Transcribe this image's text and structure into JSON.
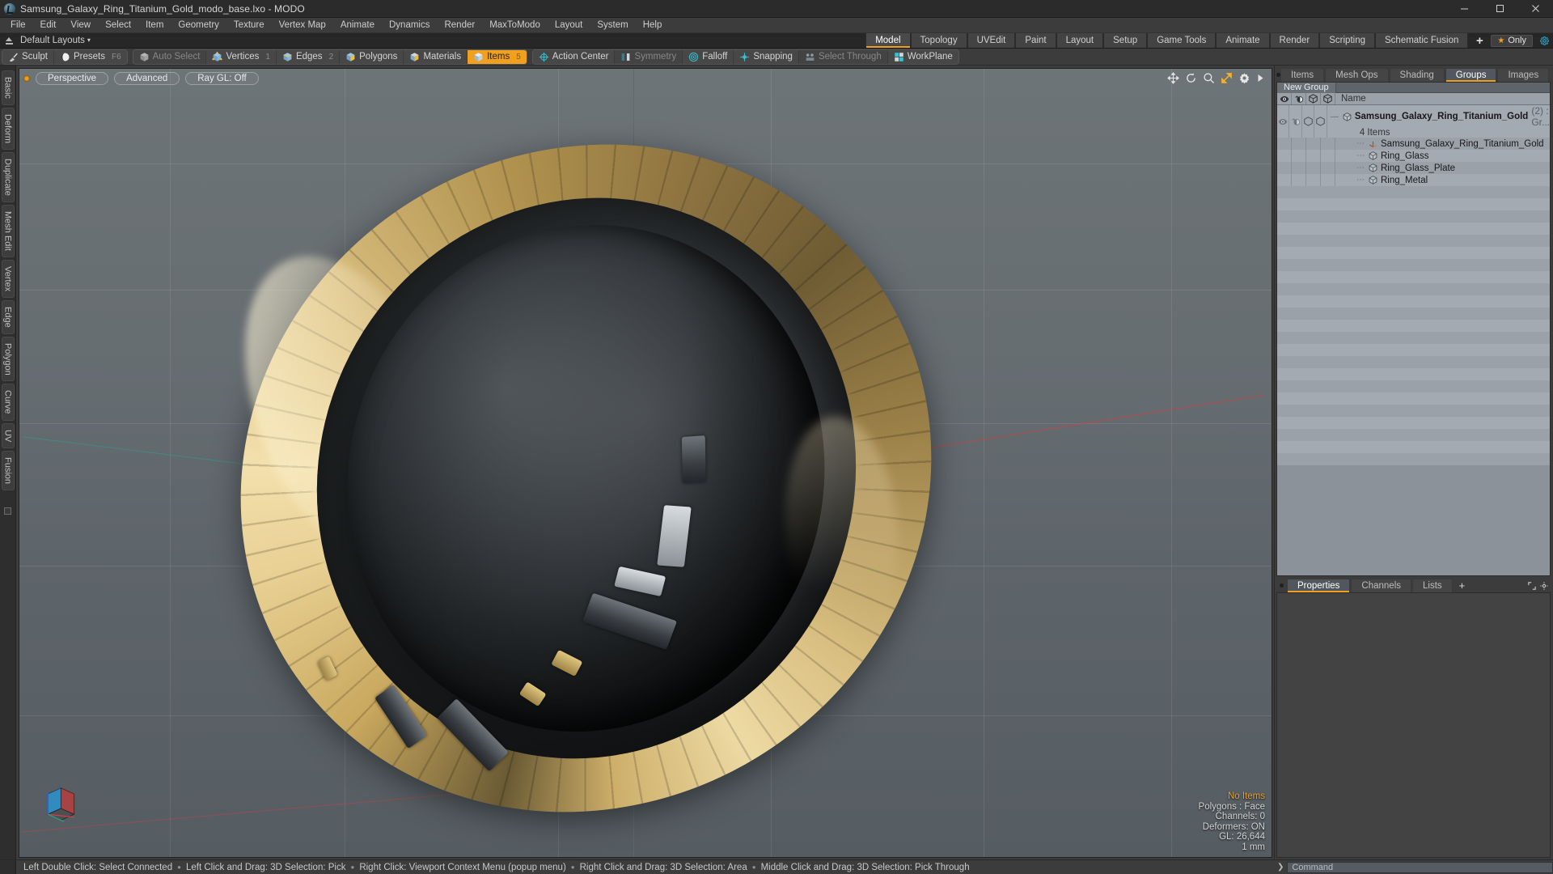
{
  "window": {
    "title": "Samsung_Galaxy_Ring_Titanium_Gold_modo_base.lxo - MODO",
    "minimize": "–",
    "maximize": "❐",
    "close": "✕"
  },
  "menubar": {
    "items": [
      "File",
      "Edit",
      "View",
      "Select",
      "Item",
      "Geometry",
      "Texture",
      "Vertex Map",
      "Animate",
      "Dynamics",
      "Render",
      "MaxToModo",
      "Layout",
      "System",
      "Help"
    ]
  },
  "layoutbar": {
    "default_layouts": "Default Layouts",
    "caret": "▾",
    "tabs": [
      {
        "label": "Model",
        "active": true
      },
      {
        "label": "Topology",
        "active": false
      },
      {
        "label": "UVEdit",
        "active": false
      },
      {
        "label": "Paint",
        "active": false
      },
      {
        "label": "Layout",
        "active": false
      },
      {
        "label": "Setup",
        "active": false
      },
      {
        "label": "Game Tools",
        "active": false
      },
      {
        "label": "Animate",
        "active": false
      },
      {
        "label": "Render",
        "active": false
      },
      {
        "label": "Scripting",
        "active": false
      },
      {
        "label": "Schematic Fusion",
        "active": false
      }
    ],
    "add_tab": "+",
    "only_label": "Only",
    "star": "★"
  },
  "toolbar": {
    "groups": [
      {
        "buttons": [
          {
            "label": "Sculpt",
            "icon": "brush-icon",
            "state": "normal",
            "key": ""
          },
          {
            "label": "Presets",
            "icon": "sphere-icon",
            "state": "normal",
            "key": "F6"
          }
        ]
      },
      {
        "buttons": [
          {
            "label": "Auto Select",
            "icon": "cube-grey-icon",
            "state": "dim",
            "key": ""
          },
          {
            "label": "Vertices",
            "icon": "cube-vertex-icon",
            "state": "normal",
            "key": "1"
          },
          {
            "label": "Edges",
            "icon": "cube-edge-icon",
            "state": "normal",
            "key": "2"
          },
          {
            "label": "Polygons",
            "icon": "cube-poly-icon",
            "state": "normal",
            "key": ""
          },
          {
            "label": "Materials",
            "icon": "cube-material-icon",
            "state": "normal",
            "key": ""
          },
          {
            "label": "Items",
            "icon": "cube-item-icon",
            "state": "active",
            "key": "5"
          }
        ]
      },
      {
        "buttons": [
          {
            "label": "Action Center",
            "icon": "action-center-icon",
            "state": "normal",
            "key": ""
          },
          {
            "label": "Symmetry",
            "icon": "symmetry-icon",
            "state": "dim",
            "key": ""
          },
          {
            "label": "Falloff",
            "icon": "falloff-icon",
            "state": "normal",
            "key": ""
          },
          {
            "label": "Snapping",
            "icon": "snapping-icon",
            "state": "normal",
            "key": ""
          },
          {
            "label": "Select Through",
            "icon": "select-through-icon",
            "state": "dim",
            "key": ""
          },
          {
            "label": "WorkPlane",
            "icon": "workplane-icon",
            "state": "normal",
            "key": ""
          }
        ]
      }
    ]
  },
  "left_tabs": [
    "Basic",
    "Deform",
    "Duplicate",
    "Mesh Edit",
    "Vertex",
    "Edge",
    "Polygon",
    "Curve",
    "UV",
    "Fusion"
  ],
  "viewport": {
    "pills": [
      "Perspective",
      "Advanced",
      "Ray GL: Off"
    ],
    "tool_icons": [
      "move-icon",
      "rotate-icon",
      "zoom-icon",
      "fit-icon",
      "gear-icon",
      "chevron-right-icon"
    ],
    "stats": {
      "selection": "No Items",
      "polygons": "Polygons : Face",
      "channels": "Channels: 0",
      "deformers": "Deformers: ON",
      "gl": "GL: 26,644",
      "units": "1 mm"
    }
  },
  "right_panel": {
    "tabs": [
      {
        "label": "Items",
        "active": false
      },
      {
        "label": "Mesh Ops",
        "active": false
      },
      {
        "label": "Shading",
        "active": false
      },
      {
        "label": "Groups",
        "active": true
      },
      {
        "label": "Images",
        "active": false
      }
    ],
    "add_tab": "+",
    "group_chip": "New Group",
    "columns": [
      "eye-icon",
      "render-icon",
      "wire-icon",
      "shade-icon"
    ],
    "name_header": "Name",
    "tree": [
      {
        "label": "Samsung_Galaxy_Ring_Titanium_Gold",
        "meta": "(2) : Gr...",
        "icon": "group-cube-icon",
        "level": 0,
        "bold": true
      },
      {
        "label": "4 Items",
        "icon": "",
        "level": 1,
        "bold": false,
        "sub": true
      },
      {
        "label": "Samsung_Galaxy_Ring_Titanium_Gold",
        "icon": "locator-icon",
        "level": 2,
        "bold": false
      },
      {
        "label": "Ring_Glass",
        "icon": "mesh-cube-icon",
        "level": 2,
        "bold": false
      },
      {
        "label": "Ring_Glass_Plate",
        "icon": "mesh-cube-icon",
        "level": 2,
        "bold": false
      },
      {
        "label": "Ring_Metal",
        "icon": "mesh-cube-icon",
        "level": 2,
        "bold": false
      }
    ],
    "lower_tabs": [
      {
        "label": "Properties",
        "active": true
      },
      {
        "label": "Channels",
        "active": false
      },
      {
        "label": "Lists",
        "active": false
      }
    ],
    "lower_add_tab": "+"
  },
  "statusbar": {
    "hints": [
      "Left Double Click: Select Connected",
      "Left Click and Drag: 3D Selection: Pick",
      "Right Click: Viewport Context Menu (popup menu)",
      "Right Click and Drag: 3D Selection: Area",
      "Middle Click and Drag: 3D Selection: Pick Through"
    ],
    "separator": "●",
    "command_placeholder": "Command",
    "command_value": "",
    "command_arrow": "❯"
  },
  "colors": {
    "accent": "#f0a020",
    "panel": "#3c3c3c",
    "tree_bg": "#9aa1a8",
    "gold": "#e8cf92"
  }
}
